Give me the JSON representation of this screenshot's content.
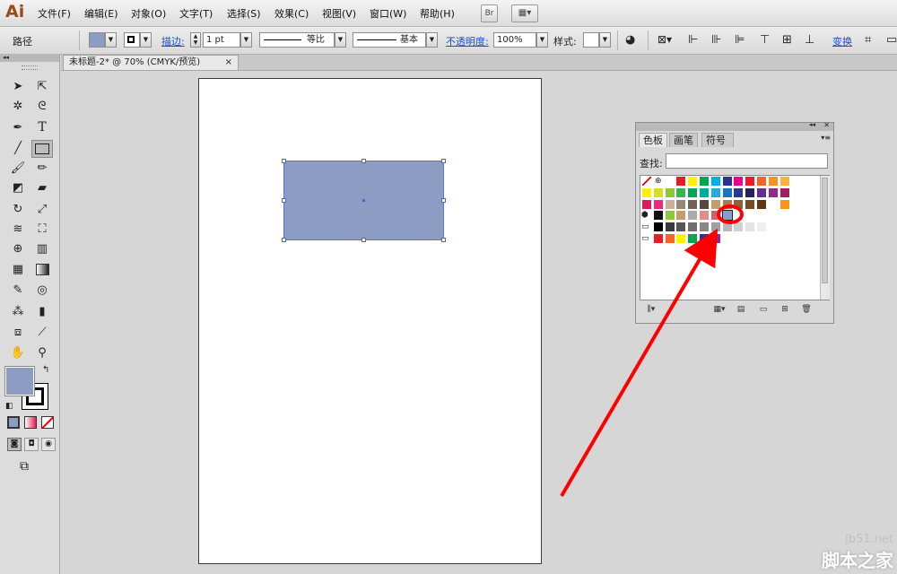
{
  "app": {
    "logo": "Ai"
  },
  "menu": [
    "文件(F)",
    "编辑(E)",
    "对象(O)",
    "文字(T)",
    "选择(S)",
    "效果(C)",
    "视图(V)",
    "窗口(W)",
    "帮助(H)"
  ],
  "menu_buttons": {
    "bridge": "Br"
  },
  "control": {
    "object_type": "路径",
    "stroke_label": "描边:",
    "stroke_weight": "1 pt",
    "profile_label": "等比",
    "brush_label": "基本",
    "opacity_label": "不透明度:",
    "opacity_value": "100%",
    "style_label": "样式:",
    "transform_label": "变换"
  },
  "document": {
    "tab_title": "未标题-2* @ 70% (CMYK/预览)",
    "close": "×"
  },
  "swatches": {
    "tabs": [
      "色板",
      "画笔",
      "符号"
    ],
    "search_label": "查找:",
    "search_value": "",
    "rows": [
      [
        "#ffffff",
        "#ffffff",
        "#ffffff",
        "#e21f26",
        "#fff200",
        "#00a651",
        "#00aeef",
        "#2e3192",
        "#ec008c",
        "#ed1c24",
        "#f26522",
        "#f7941d",
        "#fbb040"
      ],
      [
        "#fff200",
        "#d7df23",
        "#8dc63f",
        "#39b54a",
        "#00a651",
        "#00a99d",
        "#27aae1",
        "#1c75bc",
        "#2b3990",
        "#262262",
        "#662d91",
        "#92278f",
        "#9e1f63"
      ],
      [
        "#da1c5c",
        "#ee2a7b",
        "#c7b299",
        "#998675",
        "#736357",
        "#534741",
        "#c69c6d",
        "#a67c52",
        "#8c6239",
        "#754c24",
        "#603913",
        "#ffffff",
        "#f7941d"
      ],
      [
        "#111111",
        "#8dc63f",
        "#c69c6d",
        "#aaaaaa",
        "#e58a8a",
        "#cc6666",
        "#ffffff",
        "#ffffff"
      ],
      [
        "#000000",
        "#3a3a3a",
        "#555555",
        "#6e6e6e",
        "#888888",
        "#a0a0a0",
        "#b9b9b9",
        "#d1d1d1",
        "#e3e3e3",
        "#efefef",
        "#ffffff"
      ],
      [
        "#ed1c24",
        "#f26522",
        "#fff200",
        "#00a651",
        "#2e3192",
        "#92278f"
      ]
    ]
  },
  "colors": {
    "fill": "#8d9cc2",
    "selection": "#4a66d6",
    "annotation": "#ff0000"
  },
  "watermark": {
    "site": "jb51.net",
    "name": "脚本之家"
  }
}
